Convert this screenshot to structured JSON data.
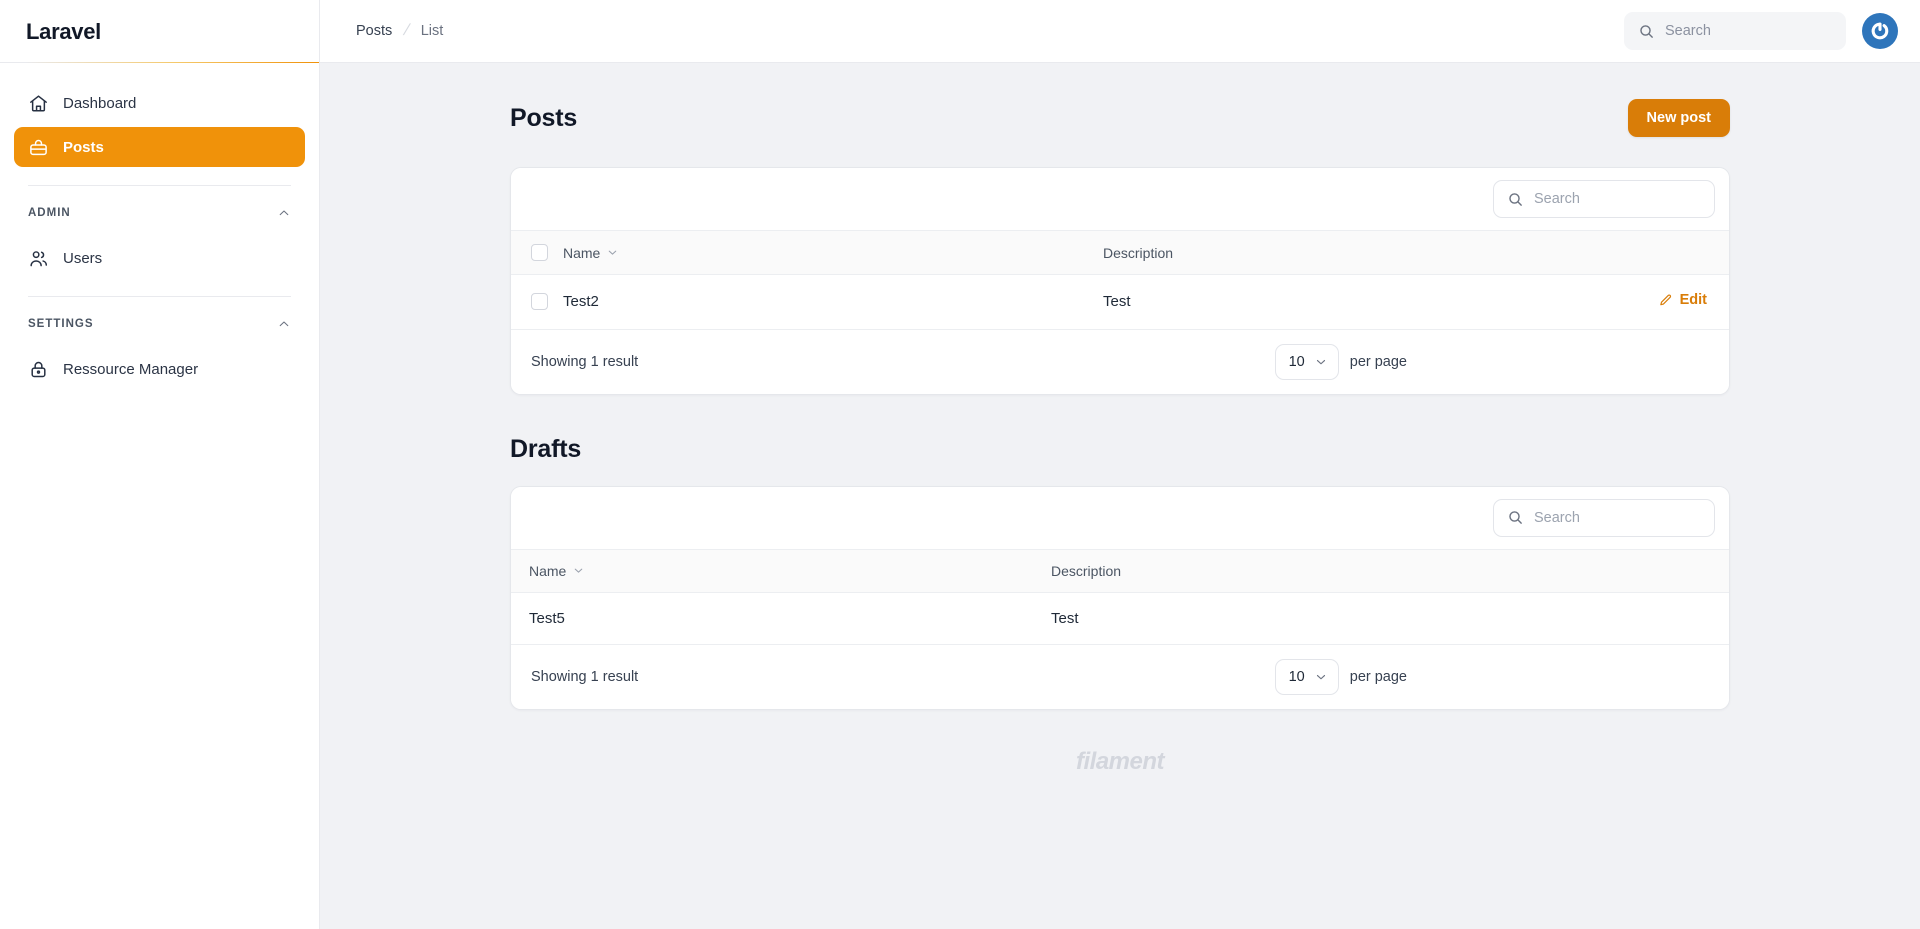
{
  "brand": {
    "name": "Laravel"
  },
  "sidebar": {
    "items": [
      {
        "label": "Dashboard",
        "icon": "home-icon",
        "active": false
      },
      {
        "label": "Posts",
        "icon": "briefcase-icon",
        "active": true
      }
    ],
    "groups": [
      {
        "label": "ADMIN",
        "collapse_icon": "chevron-up-icon",
        "items": [
          {
            "label": "Users",
            "icon": "users-icon"
          }
        ]
      },
      {
        "label": "SETTINGS",
        "collapse_icon": "chevron-up-icon",
        "items": [
          {
            "label": "Ressource Manager",
            "icon": "lock-icon"
          }
        ]
      }
    ]
  },
  "topbar": {
    "breadcrumb": [
      {
        "label": "Posts",
        "current": false
      },
      {
        "label": "List",
        "current": true
      }
    ],
    "breadcrumb_separator": "/",
    "search": {
      "placeholder": "Search",
      "value": "",
      "icon": "search-icon"
    },
    "avatar": {
      "icon": "user-avatar-icon",
      "color": "#2e75bb"
    }
  },
  "page": {
    "title": "Posts",
    "new_post_button": "New post"
  },
  "posts_table": {
    "search": {
      "placeholder": "Search",
      "value": "",
      "icon": "search-icon"
    },
    "columns": [
      {
        "key": "name",
        "label": "Name",
        "sortable": true,
        "sort_icon": "chevron-down-icon"
      },
      {
        "key": "description",
        "label": "Description",
        "sortable": false
      }
    ],
    "rows": [
      {
        "name": "Test2",
        "description": "Test",
        "action": "Edit",
        "action_icon": "pencil-icon"
      }
    ],
    "footer": {
      "result_text": "Showing 1 result",
      "per_page_value": "10",
      "per_page_label": "per page",
      "per_page_icon": "chevron-down-icon"
    }
  },
  "drafts_section": {
    "title": "Drafts",
    "search": {
      "placeholder": "Search",
      "value": "",
      "icon": "search-icon"
    },
    "columns": [
      {
        "key": "name",
        "label": "Name",
        "sortable": true,
        "sort_icon": "chevron-down-icon"
      },
      {
        "key": "description",
        "label": "Description",
        "sortable": false
      }
    ],
    "rows": [
      {
        "name": "Test5",
        "description": "Test"
      }
    ],
    "footer": {
      "result_text": "Showing 1 result",
      "per_page_value": "10",
      "per_page_label": "per page",
      "per_page_icon": "chevron-down-icon"
    }
  },
  "footer": {
    "logo_text": "filament"
  },
  "colors": {
    "accent": "#f0920a",
    "button": "#d97d08",
    "background": "#f1f2f5",
    "card": "#ffffff",
    "avatar": "#2e75bb"
  }
}
